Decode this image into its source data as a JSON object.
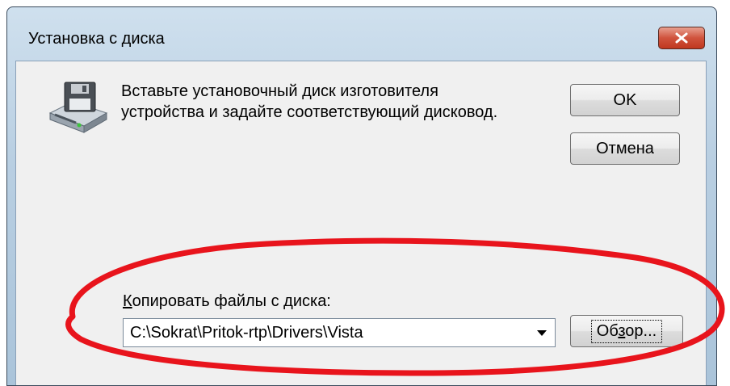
{
  "window": {
    "title": "Установка с диска",
    "close_icon": "close-icon"
  },
  "dialog": {
    "icon": "disk-drive-icon",
    "message_line1": "Вставьте установочный диск изготовителя",
    "message_line2": "устройства и задайте соответствующий дисковод.",
    "ok_label": "OK",
    "cancel_label": "Отмена",
    "copy_label_prefix": "К",
    "copy_label_rest": "опировать файлы с диска:",
    "path_value": "C:\\Sokrat\\Pritok-rtp\\Drivers\\Vista",
    "browse_label_pre": "Об",
    "browse_label_u": "з",
    "browse_label_post": "ор..."
  },
  "colors": {
    "annotation_ellipse": "#e8141c",
    "close_button": "#c0381f"
  }
}
